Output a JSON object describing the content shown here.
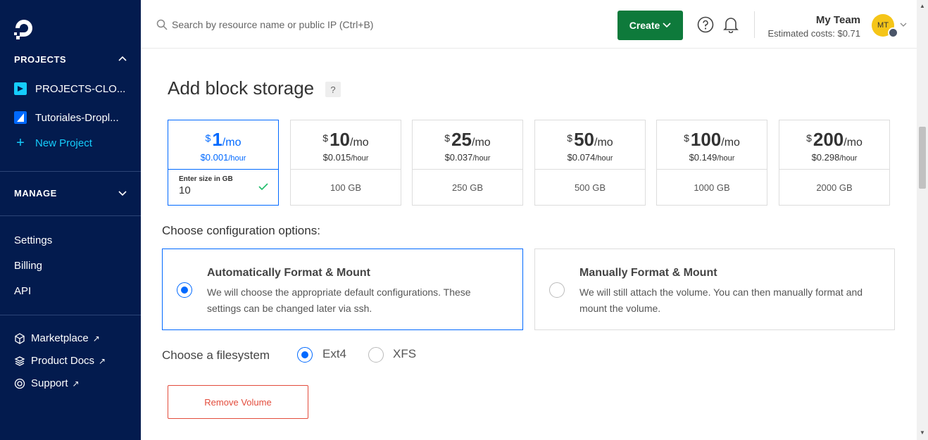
{
  "sidebar": {
    "projects_header": "PROJECTS",
    "projects": [
      {
        "label": "PROJECTS-CLO...",
        "color": "#15cdfc"
      },
      {
        "label": "Tutoriales-Dropl...",
        "color": "#0069ff"
      }
    ],
    "new_project": "New Project",
    "manage_header": "MANAGE",
    "nav": [
      "Settings",
      "Billing",
      "API"
    ],
    "external": [
      {
        "label": "Marketplace",
        "icon": "cube-icon"
      },
      {
        "label": "Product Docs",
        "icon": "layers-icon"
      },
      {
        "label": "Support",
        "icon": "lifebuoy-icon"
      }
    ]
  },
  "topbar": {
    "search_placeholder": "Search by resource name or public IP (Ctrl+B)",
    "create_label": "Create",
    "team_name": "My Team",
    "estimated_costs": "Estimated costs: $0.71",
    "avatar_initials": "MT"
  },
  "main": {
    "title": "Add block storage",
    "help_badge": "?",
    "storage_options": [
      {
        "currency": "$",
        "amount": "1",
        "per": "/mo",
        "hourly": "$0.001",
        "hour_unit": "/hour",
        "size": "",
        "selected": true
      },
      {
        "currency": "$",
        "amount": "10",
        "per": "/mo",
        "hourly": "$0.015",
        "hour_unit": "/hour",
        "size": "100 GB",
        "selected": false
      },
      {
        "currency": "$",
        "amount": "25",
        "per": "/mo",
        "hourly": "$0.037",
        "hour_unit": "/hour",
        "size": "250 GB",
        "selected": false
      },
      {
        "currency": "$",
        "amount": "50",
        "per": "/mo",
        "hourly": "$0.074",
        "hour_unit": "/hour",
        "size": "500 GB",
        "selected": false
      },
      {
        "currency": "$",
        "amount": "100",
        "per": "/mo",
        "hourly": "$0.149",
        "hour_unit": "/hour",
        "size": "1000 GB",
        "selected": false
      },
      {
        "currency": "$",
        "amount": "200",
        "per": "/mo",
        "hourly": "$0.298",
        "hour_unit": "/hour",
        "size": "2000 GB",
        "selected": false
      }
    ],
    "custom_size_label": "Enter size in GB",
    "custom_size_value": "10",
    "config_heading": "Choose configuration options:",
    "config_options": [
      {
        "title": "Automatically Format & Mount",
        "desc": "We will choose the appropriate default configurations. These settings can be changed later via ssh.",
        "selected": true
      },
      {
        "title": "Manually Format & Mount",
        "desc": "We will still attach the volume. You can then manually format and mount the volume.",
        "selected": false
      }
    ],
    "filesystem_label": "Choose a filesystem",
    "filesystems": [
      {
        "label": "Ext4",
        "selected": true
      },
      {
        "label": "XFS",
        "selected": false
      }
    ],
    "remove_label": "Remove Volume"
  },
  "colors": {
    "sidebar_bg": "#031b4e",
    "accent": "#0069ff",
    "create_green": "#0e7a3b",
    "danger": "#e34c3c"
  }
}
